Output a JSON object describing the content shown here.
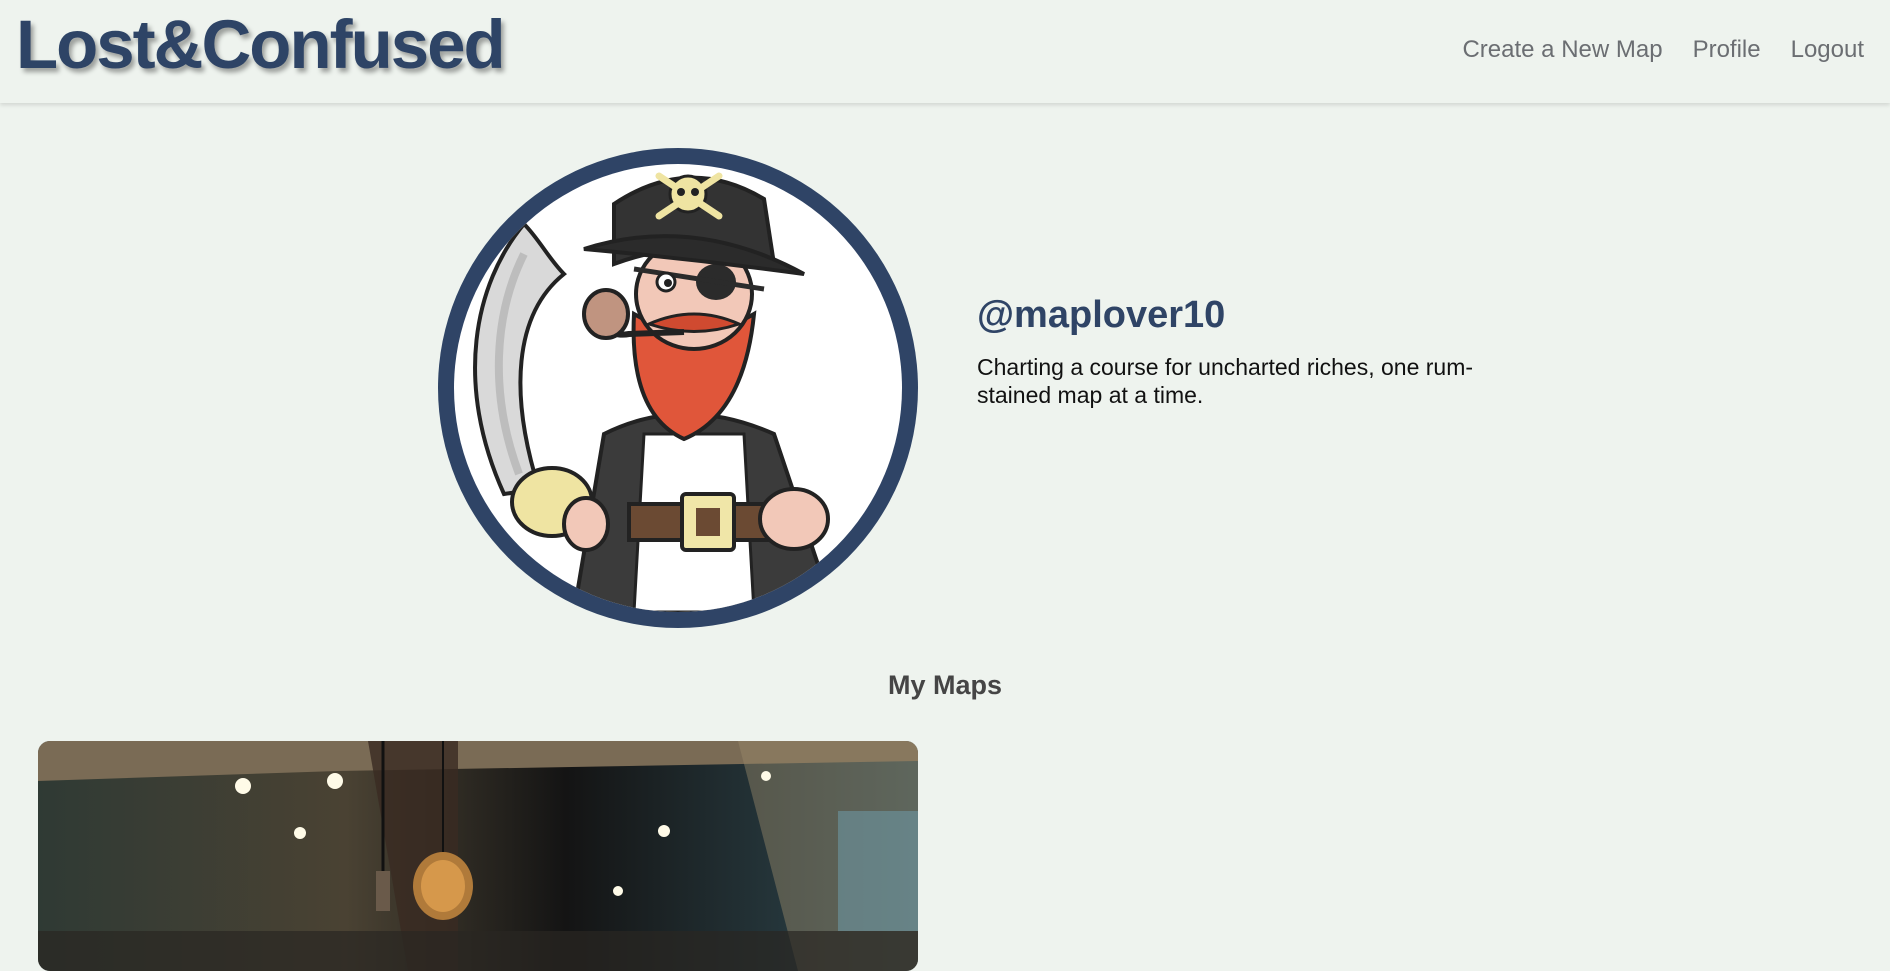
{
  "navbar": {
    "brand": "Lost&Confused",
    "links": [
      {
        "label": "Create a New Map"
      },
      {
        "label": "Profile"
      },
      {
        "label": "Logout"
      }
    ]
  },
  "profile": {
    "avatar_icon": "pirate-avatar",
    "username": "@maplover10",
    "bio": "Charting a course for uncharted riches, one rum-stained map at a time."
  },
  "maps_section": {
    "title": "My Maps",
    "cards": [
      {
        "image": "restaurant-interior-photo"
      }
    ]
  }
}
